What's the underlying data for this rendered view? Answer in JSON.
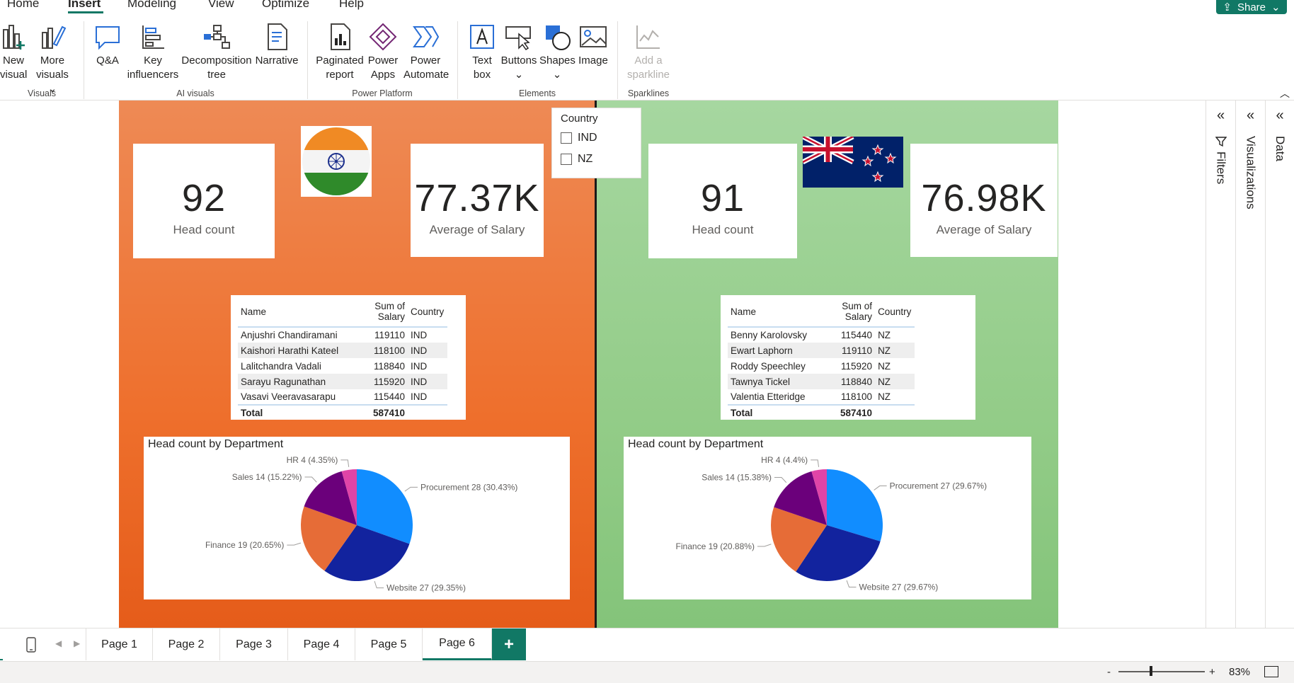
{
  "menu": {
    "tabs": [
      "Home",
      "Insert",
      "Modeling",
      "View",
      "Optimize",
      "Help"
    ],
    "active": "Insert",
    "share_label": "Share"
  },
  "ribbon": {
    "visuals": {
      "new_visual": "New visual",
      "more_visuals": "More visuals",
      "group": "Visuals"
    },
    "ai": {
      "qna": "Q&A",
      "key_influencers": "Key influencers",
      "decomposition": "Decomposition tree",
      "narrative": "Narrative",
      "group": "AI visuals"
    },
    "power": {
      "paginated": "Paginated report",
      "apps": "Power Apps",
      "automate": "Power Automate",
      "group": "Power Platform"
    },
    "elements": {
      "textbox": "Text box",
      "buttons": "Buttons",
      "shapes": "Shapes",
      "image": "Image",
      "group": "Elements"
    },
    "sparklines": {
      "add": "Add a sparkline",
      "group": "Sparklines"
    }
  },
  "slicer": {
    "title": "Country",
    "options": [
      "IND",
      "NZ"
    ]
  },
  "ind": {
    "headcount": {
      "value": "92",
      "label": "Head count"
    },
    "salary": {
      "value": "77.37K",
      "label": "Average of Salary"
    },
    "table": {
      "headers": [
        "Name",
        "Sum of Salary",
        "Country"
      ],
      "rows": [
        [
          "Anjushri Chandiramani",
          "119110",
          "IND"
        ],
        [
          "Kaishori Harathi Kateel",
          "118100",
          "IND"
        ],
        [
          "Lalitchandra Vadali",
          "118840",
          "IND"
        ],
        [
          "Sarayu Ragunathan",
          "115920",
          "IND"
        ],
        [
          "Vasavi Veeravasarapu",
          "115440",
          "IND"
        ]
      ],
      "total_label": "Total",
      "total_value": "587410"
    },
    "chart_data": {
      "type": "pie",
      "title": "Head count by Department",
      "slices": [
        {
          "label": "Procurement 28 (30.43%)",
          "value": 28,
          "color": "#118dff"
        },
        {
          "label": "Website 27 (29.35%)",
          "value": 27,
          "color": "#12239e"
        },
        {
          "label": "Finance 19 (20.65%)",
          "value": 19,
          "color": "#e66c37"
        },
        {
          "label": "Sales 14 (15.22%)",
          "value": 14,
          "color": "#6b007b"
        },
        {
          "label": "HR 4 (4.35%)",
          "value": 4,
          "color": "#e044a7"
        }
      ]
    }
  },
  "nz": {
    "headcount": {
      "value": "91",
      "label": "Head count"
    },
    "salary": {
      "value": "76.98K",
      "label": "Average of Salary"
    },
    "table": {
      "headers": [
        "Name",
        "Sum of Salary",
        "Country"
      ],
      "rows": [
        [
          "Benny Karolovsky",
          "115440",
          "NZ"
        ],
        [
          "Ewart Laphorn",
          "119110",
          "NZ"
        ],
        [
          "Roddy Speechley",
          "115920",
          "NZ"
        ],
        [
          "Tawnya Tickel",
          "118840",
          "NZ"
        ],
        [
          "Valentia Etteridge",
          "118100",
          "NZ"
        ]
      ],
      "total_label": "Total",
      "total_value": "587410"
    },
    "chart_data": {
      "type": "pie",
      "title": "Head count by Department",
      "slices": [
        {
          "label": "Procurement 27 (29.67%)",
          "value": 27,
          "color": "#118dff"
        },
        {
          "label": "Website 27 (29.67%)",
          "value": 27,
          "color": "#12239e"
        },
        {
          "label": "Finance 19 (20.88%)",
          "value": 19,
          "color": "#e66c37"
        },
        {
          "label": "Sales 14 (15.38%)",
          "value": 14,
          "color": "#6b007b"
        },
        {
          "label": "HR 4 (4.4%)",
          "value": 4,
          "color": "#e044a7"
        }
      ]
    }
  },
  "panes": {
    "filters": "Filters",
    "visualizations": "Visualizations",
    "data": "Data"
  },
  "pages": {
    "tabs": [
      "Page 1",
      "Page 2",
      "Page 3",
      "Page 4",
      "Page 5",
      "Page 6"
    ],
    "active": "Page 6",
    "add": "+"
  },
  "status": {
    "zoom": "83%",
    "minus": "-",
    "plus": "+"
  },
  "colors": {
    "accent": "#117865",
    "ind_bg": "#ee6f2c",
    "nz_bg": "#93cc88"
  },
  "icons": [
    "new-visual-icon",
    "more-visuals-icon",
    "qna-icon",
    "key-influencers-icon",
    "decomposition-tree-icon",
    "narrative-icon",
    "paginated-report-icon",
    "power-apps-icon",
    "power-automate-icon",
    "text-box-icon",
    "buttons-icon",
    "shapes-icon",
    "image-icon",
    "sparkline-icon",
    "india-flag-icon",
    "nz-flag-icon",
    "filter-icon",
    "mobile-layout-icon",
    "fit-page-icon"
  ]
}
